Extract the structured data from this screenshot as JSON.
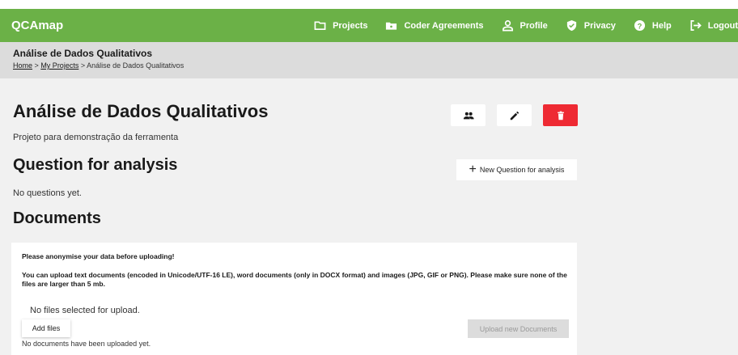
{
  "app": {
    "brand": "QCAmap"
  },
  "nav": {
    "items": [
      {
        "label": "Projects",
        "icon": "folder-icon"
      },
      {
        "label": "Coder Agreements",
        "icon": "id-card-icon"
      },
      {
        "label": "Profile",
        "icon": "user-icon"
      },
      {
        "label": "Privacy",
        "icon": "shield-icon"
      },
      {
        "label": "Help",
        "icon": "help-icon"
      },
      {
        "label": "Logout",
        "icon": "logout-icon"
      }
    ]
  },
  "header": {
    "title": "Análise de Dados Qualitativos",
    "breadcrumb": {
      "home": "Home",
      "sep1": ">",
      "projects": "My Projects",
      "sep2": ">",
      "current": "Análise de Dados Qualitativos"
    }
  },
  "project": {
    "title": "Análise de Dados Qualitativos",
    "description": "Projeto para demonstração da ferramenta",
    "actions": [
      {
        "icon": "people-icon"
      },
      {
        "icon": "pencil-icon"
      },
      {
        "icon": "trash-icon",
        "color": "#ee2a33"
      }
    ]
  },
  "questions": {
    "heading": "Question for analysis",
    "new_button": "New Question for analysis",
    "empty": "No questions yet."
  },
  "documents": {
    "heading": "Documents",
    "warning": "Please anonymise your data before uploading!",
    "info": "You can upload text documents (encoded in Unicode/UTF-16 LE), word documents (only in DOCX format) and images (JPG, GIF or PNG). Please make sure none of the files are larger than 5 mb.",
    "no_files": "No files selected for upload.",
    "add_button": "Add files",
    "upload_button": "Upload new Documents",
    "empty": "No documents have been uploaded yet."
  },
  "colors": {
    "brand": "#6bb147",
    "danger": "#ee2a33"
  }
}
